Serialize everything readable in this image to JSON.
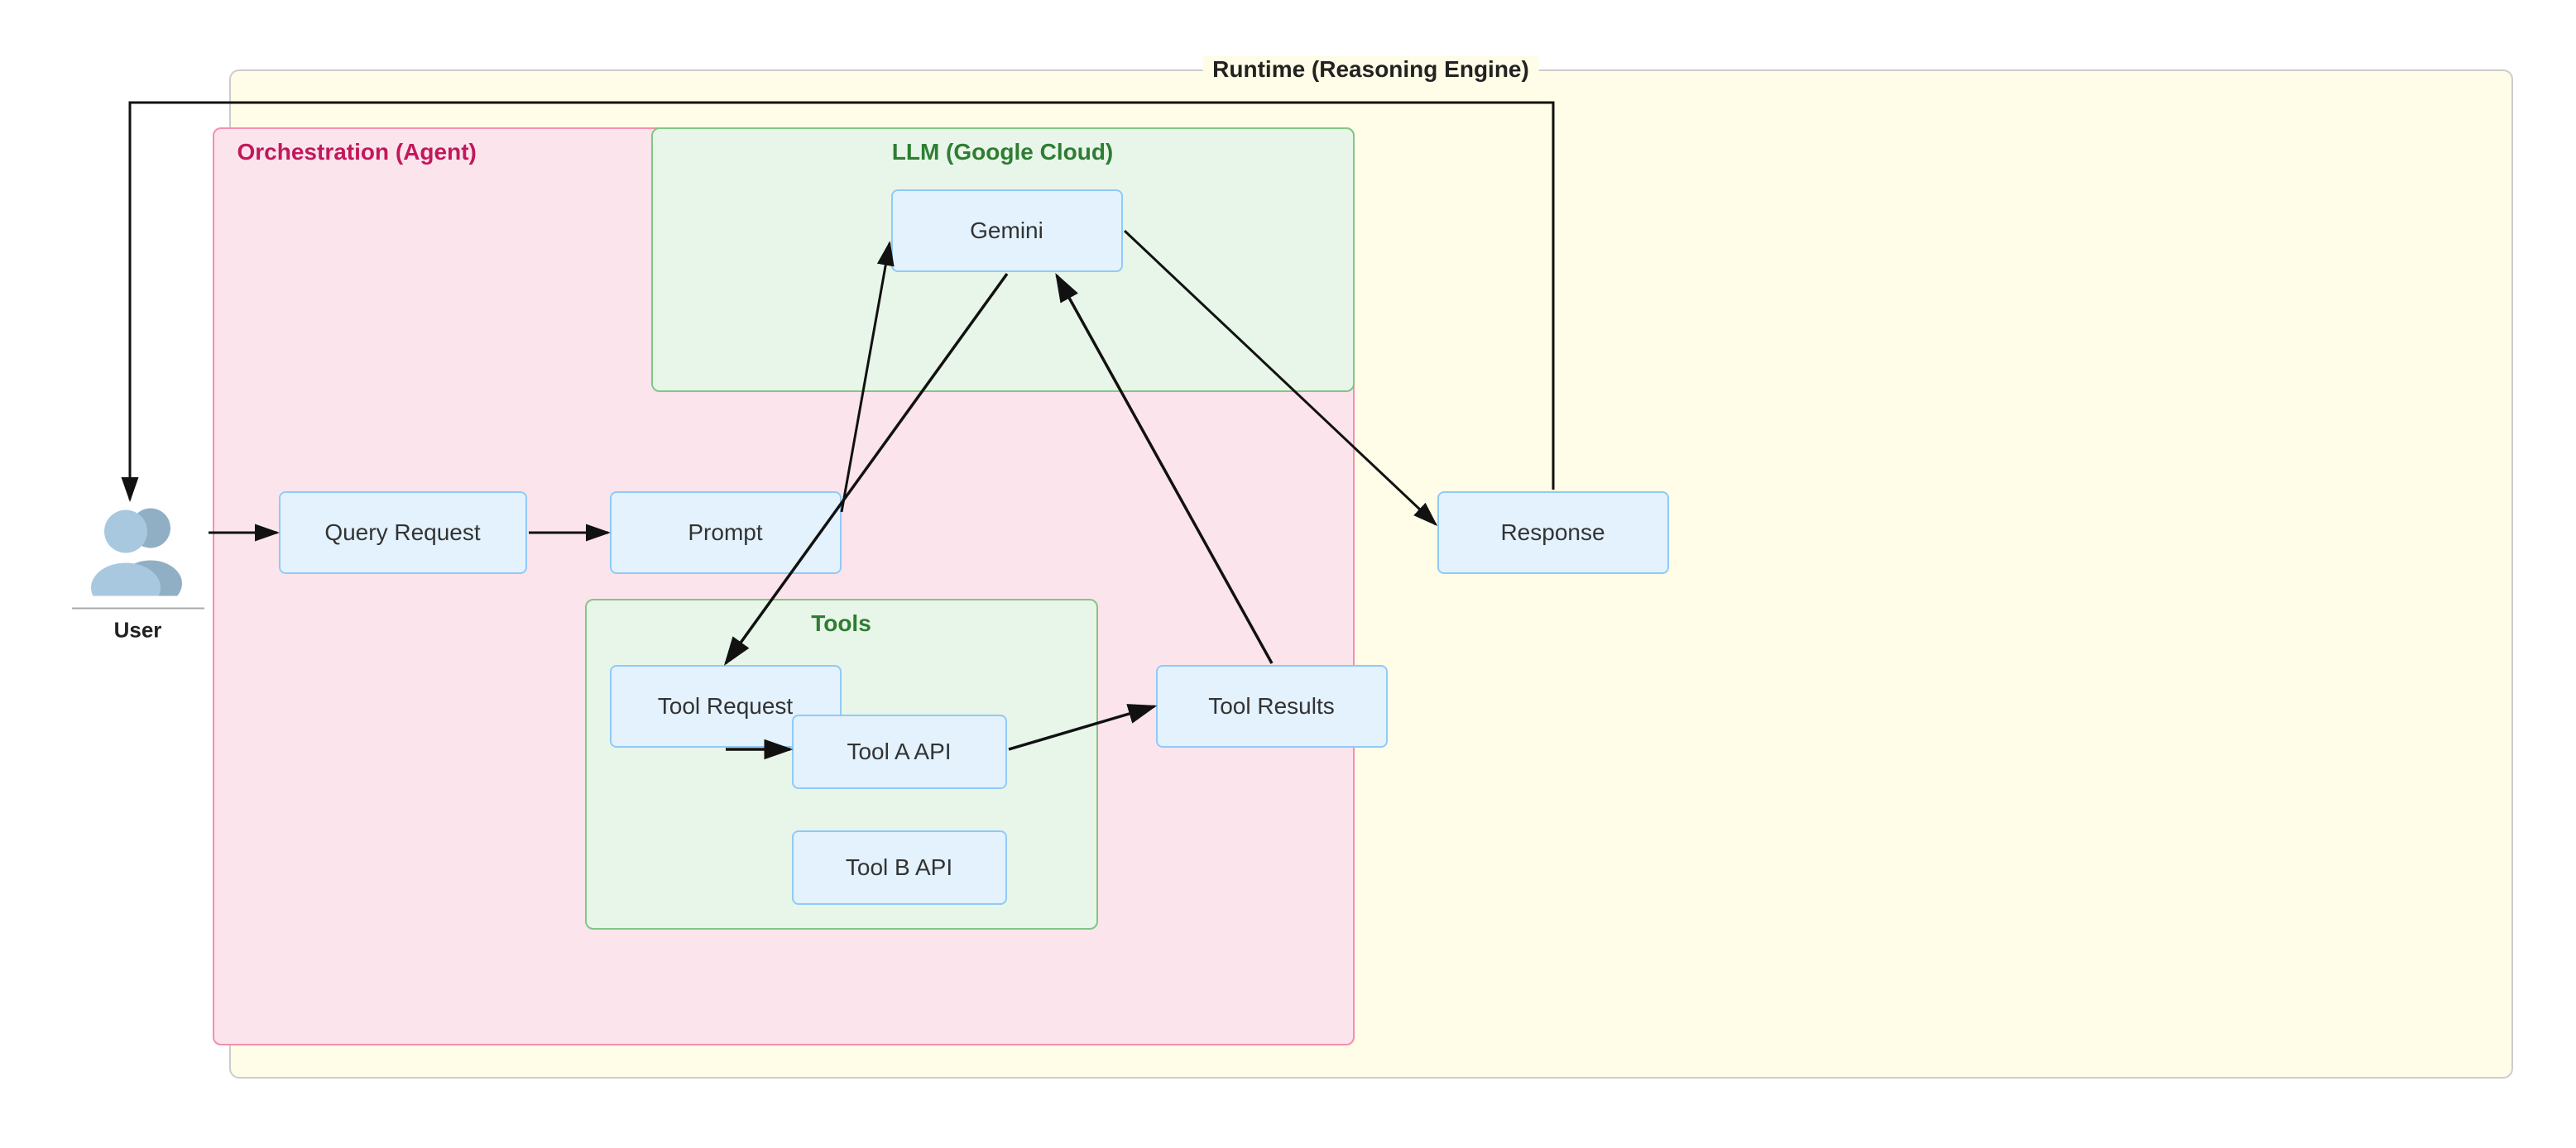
{
  "diagram": {
    "title": "Runtime (Reasoning Engine)",
    "orchestration_label": "Orchestration (Agent)",
    "llm_label": "LLM (Google Cloud)",
    "tools_label": "Tools",
    "user_label": "User",
    "nodes": {
      "query_request": "Query Request",
      "prompt": "Prompt",
      "gemini": "Gemini",
      "response": "Response",
      "tool_request": "Tool Request",
      "tool_results": "Tool Results",
      "tool_a": "Tool A API",
      "tool_b": "Tool B API"
    }
  }
}
